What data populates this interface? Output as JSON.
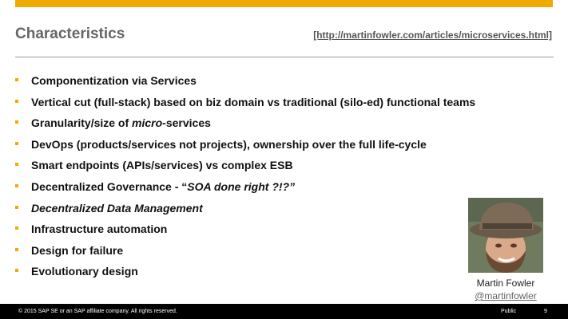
{
  "slide": {
    "title": "Characteristics",
    "source_link": "[http://martinfowler.com/articles/microservices.html]",
    "bullets": [
      {
        "parts": [
          {
            "text": "Componentization via Services",
            "italic": false
          }
        ]
      },
      {
        "parts": [
          {
            "text": "Vertical cut (full-stack) based on biz domain vs traditional (silo-ed) functional teams",
            "italic": false
          }
        ]
      },
      {
        "parts": [
          {
            "text": "Granularity/size of ",
            "italic": false
          },
          {
            "text": "micro",
            "italic": true
          },
          {
            "text": "-services",
            "italic": false
          }
        ]
      },
      {
        "parts": [
          {
            "text": "DevOps (products/services not projects), ownership over the full life-cycle",
            "italic": false
          }
        ]
      },
      {
        "parts": [
          {
            "text": "Smart endpoints (APIs/services) vs complex ESB",
            "italic": false
          }
        ]
      },
      {
        "parts": [
          {
            "text": "Decentralized Governance - “",
            "italic": false
          },
          {
            "text": "SOA done right ?!?”",
            "italic": true
          }
        ]
      },
      {
        "parts": [
          {
            "text": "Decentralized Data Management",
            "italic": true
          }
        ]
      },
      {
        "parts": [
          {
            "text": "Infrastructure automation",
            "italic": false
          }
        ]
      },
      {
        "parts": [
          {
            "text": "Design for failure",
            "italic": false
          }
        ]
      },
      {
        "parts": [
          {
            "text": "Evolutionary design",
            "italic": false
          }
        ]
      }
    ],
    "person": {
      "name": "Martin Fowler",
      "handle": "@martinfowler"
    }
  },
  "footer": {
    "copyright": "© 2015 SAP SE or an SAP affiliate company. All rights reserved.",
    "classification": "Public",
    "page_number": "9"
  },
  "colors": {
    "accent": "#f0ab00",
    "footer_bg": "#000000"
  }
}
